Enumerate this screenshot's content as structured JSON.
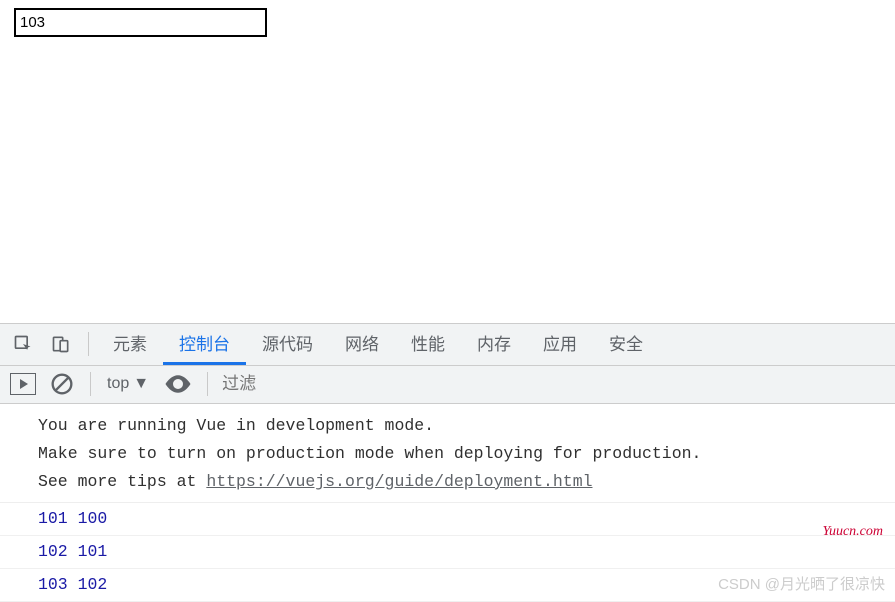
{
  "page": {
    "input_value": "103"
  },
  "devtools": {
    "tabs": {
      "elements": "元素",
      "console": "控制台",
      "sources": "源代码",
      "network": "网络",
      "performance": "性能",
      "memory": "内存",
      "application": "应用",
      "security": "安全"
    },
    "context": "top",
    "filter_placeholder": "过滤"
  },
  "console": {
    "msg_line1": "You are running Vue in development mode.",
    "msg_line2": "Make sure to turn on production mode when deploying for production.",
    "msg_line3_prefix": "See more tips at ",
    "msg_line3_link": "https://vuejs.org/guide/deployment.html",
    "logs": [
      {
        "a": "101",
        "b": "100"
      },
      {
        "a": "102",
        "b": "101"
      },
      {
        "a": "103",
        "b": "102"
      }
    ]
  },
  "watermarks": {
    "site": "Yuucn.com",
    "author": "CSDN @月光晒了很凉快"
  }
}
